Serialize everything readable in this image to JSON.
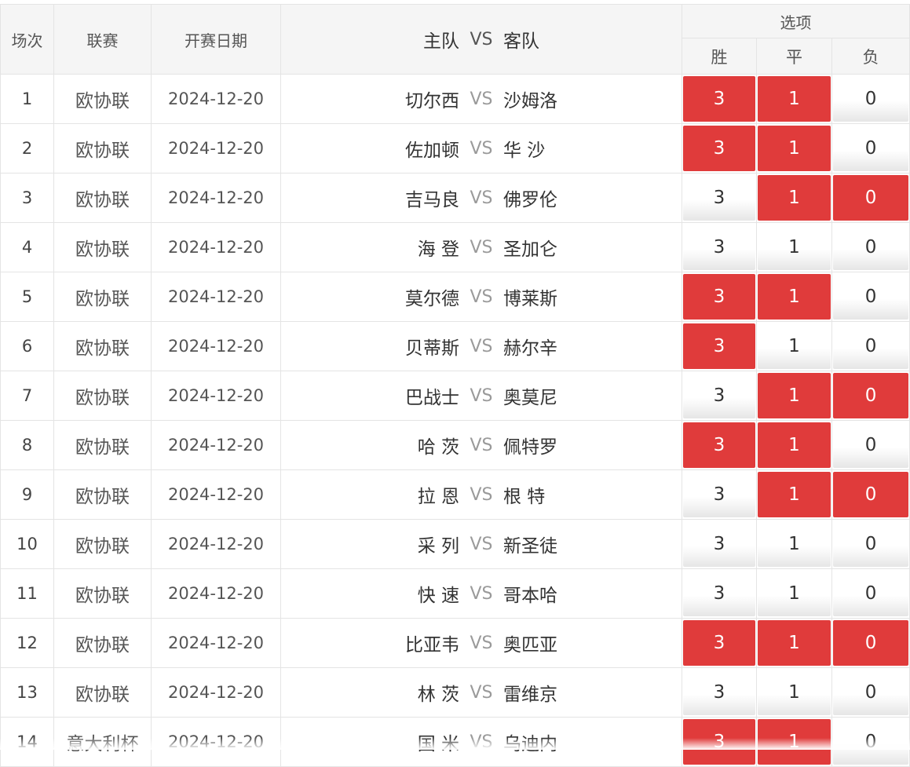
{
  "header": {
    "num": "场次",
    "league": "联赛",
    "date": "开赛日期",
    "home": "主队",
    "vs": "VS",
    "away": "客队",
    "options": "选项",
    "win": "胜",
    "draw": "平",
    "lose": "负"
  },
  "colors": {
    "selected": "#e03b3b",
    "border": "#e4e4e4",
    "header_bg": "#f5f5f5",
    "vs_text": "#9a9a9a"
  },
  "rows": [
    {
      "num": "1",
      "league": "欧协联",
      "date": "2024-12-20",
      "home": "切尔西",
      "vs": "VS",
      "away": "沙姆洛",
      "win": "3",
      "draw": "1",
      "lose": "0",
      "sel": {
        "win": true,
        "draw": true,
        "lose": false
      }
    },
    {
      "num": "2",
      "league": "欧协联",
      "date": "2024-12-20",
      "home": "佐加顿",
      "vs": "VS",
      "away": "华 沙",
      "win": "3",
      "draw": "1",
      "lose": "0",
      "sel": {
        "win": true,
        "draw": true,
        "lose": false
      }
    },
    {
      "num": "3",
      "league": "欧协联",
      "date": "2024-12-20",
      "home": "吉马良",
      "vs": "VS",
      "away": "佛罗伦",
      "win": "3",
      "draw": "1",
      "lose": "0",
      "sel": {
        "win": false,
        "draw": true,
        "lose": true
      }
    },
    {
      "num": "4",
      "league": "欧协联",
      "date": "2024-12-20",
      "home": "海 登",
      "vs": "VS",
      "away": "圣加仑",
      "win": "3",
      "draw": "1",
      "lose": "0",
      "sel": {
        "win": false,
        "draw": false,
        "lose": false
      }
    },
    {
      "num": "5",
      "league": "欧协联",
      "date": "2024-12-20",
      "home": "莫尔德",
      "vs": "VS",
      "away": "博莱斯",
      "win": "3",
      "draw": "1",
      "lose": "0",
      "sel": {
        "win": true,
        "draw": true,
        "lose": false
      }
    },
    {
      "num": "6",
      "league": "欧协联",
      "date": "2024-12-20",
      "home": "贝蒂斯",
      "vs": "VS",
      "away": "赫尔辛",
      "win": "3",
      "draw": "1",
      "lose": "0",
      "sel": {
        "win": true,
        "draw": false,
        "lose": false
      }
    },
    {
      "num": "7",
      "league": "欧协联",
      "date": "2024-12-20",
      "home": "巴战士",
      "vs": "VS",
      "away": "奥莫尼",
      "win": "3",
      "draw": "1",
      "lose": "0",
      "sel": {
        "win": false,
        "draw": true,
        "lose": true
      }
    },
    {
      "num": "8",
      "league": "欧协联",
      "date": "2024-12-20",
      "home": "哈 茨",
      "vs": "VS",
      "away": "佩特罗",
      "win": "3",
      "draw": "1",
      "lose": "0",
      "sel": {
        "win": true,
        "draw": true,
        "lose": false
      }
    },
    {
      "num": "9",
      "league": "欧协联",
      "date": "2024-12-20",
      "home": "拉 恩",
      "vs": "VS",
      "away": "根 特",
      "win": "3",
      "draw": "1",
      "lose": "0",
      "sel": {
        "win": false,
        "draw": true,
        "lose": true
      }
    },
    {
      "num": "10",
      "league": "欧协联",
      "date": "2024-12-20",
      "home": "采 列",
      "vs": "VS",
      "away": "新圣徒",
      "win": "3",
      "draw": "1",
      "lose": "0",
      "sel": {
        "win": false,
        "draw": false,
        "lose": false
      }
    },
    {
      "num": "11",
      "league": "欧协联",
      "date": "2024-12-20",
      "home": "快 速",
      "vs": "VS",
      "away": "哥本哈",
      "win": "3",
      "draw": "1",
      "lose": "0",
      "sel": {
        "win": false,
        "draw": false,
        "lose": false
      }
    },
    {
      "num": "12",
      "league": "欧协联",
      "date": "2024-12-20",
      "home": "比亚韦",
      "vs": "VS",
      "away": "奥匹亚",
      "win": "3",
      "draw": "1",
      "lose": "0",
      "sel": {
        "win": true,
        "draw": true,
        "lose": true
      }
    },
    {
      "num": "13",
      "league": "欧协联",
      "date": "2024-12-20",
      "home": "林 茨",
      "vs": "VS",
      "away": "雷维京",
      "win": "3",
      "draw": "1",
      "lose": "0",
      "sel": {
        "win": false,
        "draw": false,
        "lose": false
      }
    },
    {
      "num": "14",
      "league": "意大利杯",
      "date": "2024-12-20",
      "home": "国 米",
      "vs": "VS",
      "away": "乌迪内",
      "win": "3",
      "draw": "1",
      "lose": "0",
      "sel": {
        "win": true,
        "draw": true,
        "lose": false
      }
    }
  ]
}
